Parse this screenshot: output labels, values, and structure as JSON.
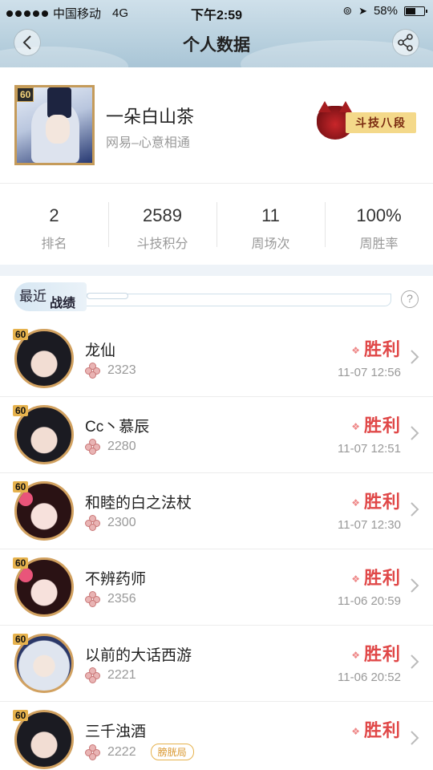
{
  "status_bar": {
    "carrier": "中国移动",
    "network": "4G",
    "time": "下午2:59",
    "battery": "58%",
    "battery_level": 0.58
  },
  "header": {
    "title": "个人数据"
  },
  "profile": {
    "level": "60",
    "name": "一朵白山茶",
    "server": "网易–心意相通",
    "rank_badge": "斗技八段"
  },
  "stats": [
    {
      "value": "2",
      "label": "排名"
    },
    {
      "value": "2589",
      "label": "斗技积分"
    },
    {
      "value": "11",
      "label": "周场次"
    },
    {
      "value": "100%",
      "label": "周胜率"
    }
  ],
  "recent": {
    "title_part1": "最近",
    "title_part2": "战绩",
    "help": "?"
  },
  "records": [
    {
      "level": "60",
      "name": "龙仙",
      "points": "2323",
      "result": "胜利",
      "time": "11-07 12:56",
      "avatar": "girl-dark",
      "tag": ""
    },
    {
      "level": "60",
      "name": "Cc丶慕辰",
      "points": "2280",
      "result": "胜利",
      "time": "11-07 12:51",
      "avatar": "girl-dark",
      "tag": ""
    },
    {
      "level": "60",
      "name": "和睦的白之法杖",
      "points": "2300",
      "result": "胜利",
      "time": "11-07 12:30",
      "avatar": "girl-pink",
      "tag": ""
    },
    {
      "level": "60",
      "name": "不辨药师",
      "points": "2356",
      "result": "胜利",
      "time": "11-06 20:59",
      "avatar": "girl-pink",
      "tag": ""
    },
    {
      "level": "60",
      "name": "以前的大话西游",
      "points": "2221",
      "result": "胜利",
      "time": "11-06 20:52",
      "avatar": "priest",
      "tag": ""
    },
    {
      "level": "60",
      "name": "三千浊酒",
      "points": "2222",
      "result": "胜利",
      "time": "",
      "avatar": "girl-dark",
      "tag": "膀胱局"
    }
  ]
}
